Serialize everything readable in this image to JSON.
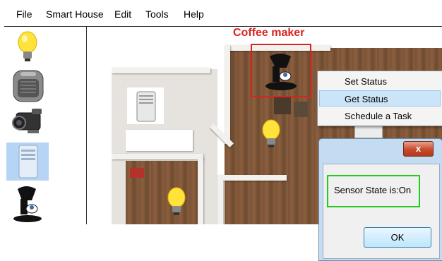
{
  "menu": {
    "items": [
      "File",
      "Smart House",
      "Edit",
      "Tools",
      "Help"
    ]
  },
  "toolbox": {
    "tools": [
      "lightbulb-icon",
      "heater-icon",
      "camera-icon",
      "air-conditioner-icon",
      "coffee-maker-icon"
    ],
    "selected_index": 3
  },
  "floorplan": {
    "coffee_label": "Coffee maker"
  },
  "context_menu": {
    "items": [
      "Set Status",
      "Get Status",
      "Schedule a Task"
    ],
    "hovered_index": 1
  },
  "dialog": {
    "close_label": "x",
    "message": "Sensor State is:On",
    "ok_label": "OK"
  },
  "colors": {
    "highlight_red": "#d8241f",
    "message_border": "#22cc22",
    "selected_tool_bg": "#b6d4f5"
  }
}
